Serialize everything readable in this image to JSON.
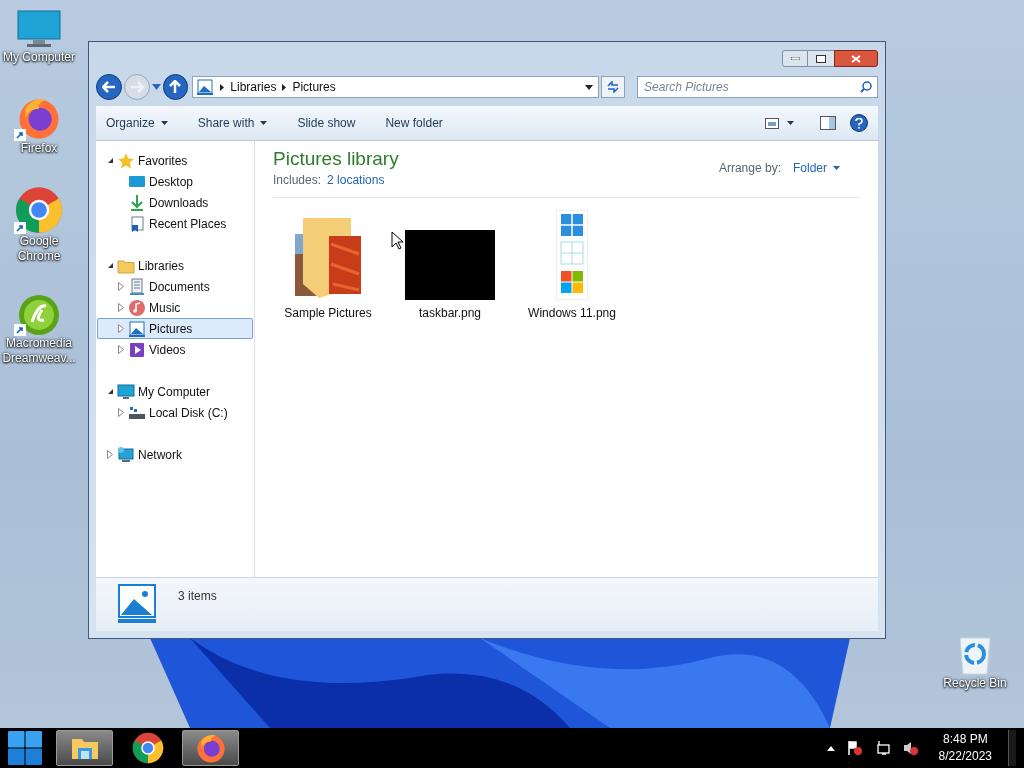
{
  "desktop_icons": [
    {
      "label": "My Computer",
      "kind": "computer",
      "shortcut": false
    },
    {
      "label": "Firefox",
      "kind": "firefox",
      "shortcut": true
    },
    {
      "label": "Google Chrome",
      "kind": "chrome",
      "shortcut": true
    },
    {
      "label": "Macromedia Dreamweav...",
      "kind": "dreamweaver",
      "shortcut": true
    }
  ],
  "recycle_bin": {
    "label": "Recycle Bin"
  },
  "window": {
    "breadcrumb": [
      "Libraries",
      "Pictures"
    ],
    "search": {
      "placeholder": "Search Pictures"
    },
    "commands": [
      {
        "label": "Organize",
        "dropdown": true
      },
      {
        "label": "Share with",
        "dropdown": true
      },
      {
        "label": "Slide show",
        "dropdown": false
      },
      {
        "label": "New folder",
        "dropdown": false
      }
    ],
    "sidebar": [
      {
        "label": "Favorites",
        "kind": "star",
        "expanded": true,
        "children": [
          {
            "label": "Desktop",
            "kind": "desktop",
            "expandable": false,
            "selected": false
          },
          {
            "label": "Downloads",
            "kind": "download",
            "expandable": false,
            "selected": false
          },
          {
            "label": "Recent Places",
            "kind": "recent",
            "expandable": false,
            "selected": false
          }
        ]
      },
      {
        "label": "Libraries",
        "kind": "folder",
        "expanded": true,
        "children": [
          {
            "label": "Documents",
            "kind": "documents",
            "expandable": true,
            "selected": false
          },
          {
            "label": "Music",
            "kind": "music",
            "expandable": true,
            "selected": false
          },
          {
            "label": "Pictures",
            "kind": "pictures",
            "expandable": true,
            "selected": true
          },
          {
            "label": "Videos",
            "kind": "videos",
            "expandable": true,
            "selected": false
          }
        ]
      },
      {
        "label": "My Computer",
        "kind": "computer",
        "expanded": true,
        "children": [
          {
            "label": "Local Disk (C:)",
            "kind": "disk",
            "expandable": true,
            "selected": false
          }
        ]
      },
      {
        "label": "Network",
        "kind": "network",
        "expanded": false
      }
    ],
    "content": {
      "title": "Pictures library",
      "includes_label": "Includes:",
      "includes_link": "2 locations",
      "arrange_label": "Arrange by:",
      "arrange_value": "Folder",
      "items": [
        {
          "name": "Sample Pictures",
          "kind": "folder"
        },
        {
          "name": "taskbar.png",
          "kind": "black-image"
        },
        {
          "name": "Windows 11.png",
          "kind": "tiles-image"
        }
      ]
    },
    "details": {
      "count": "3 items"
    }
  },
  "taskbar": {
    "apps": [
      {
        "kind": "explorer",
        "active": true
      },
      {
        "kind": "chrome",
        "active": false
      },
      {
        "kind": "firefox",
        "active": true
      }
    ],
    "time": "8:48 PM",
    "date": "8/22/2023"
  }
}
